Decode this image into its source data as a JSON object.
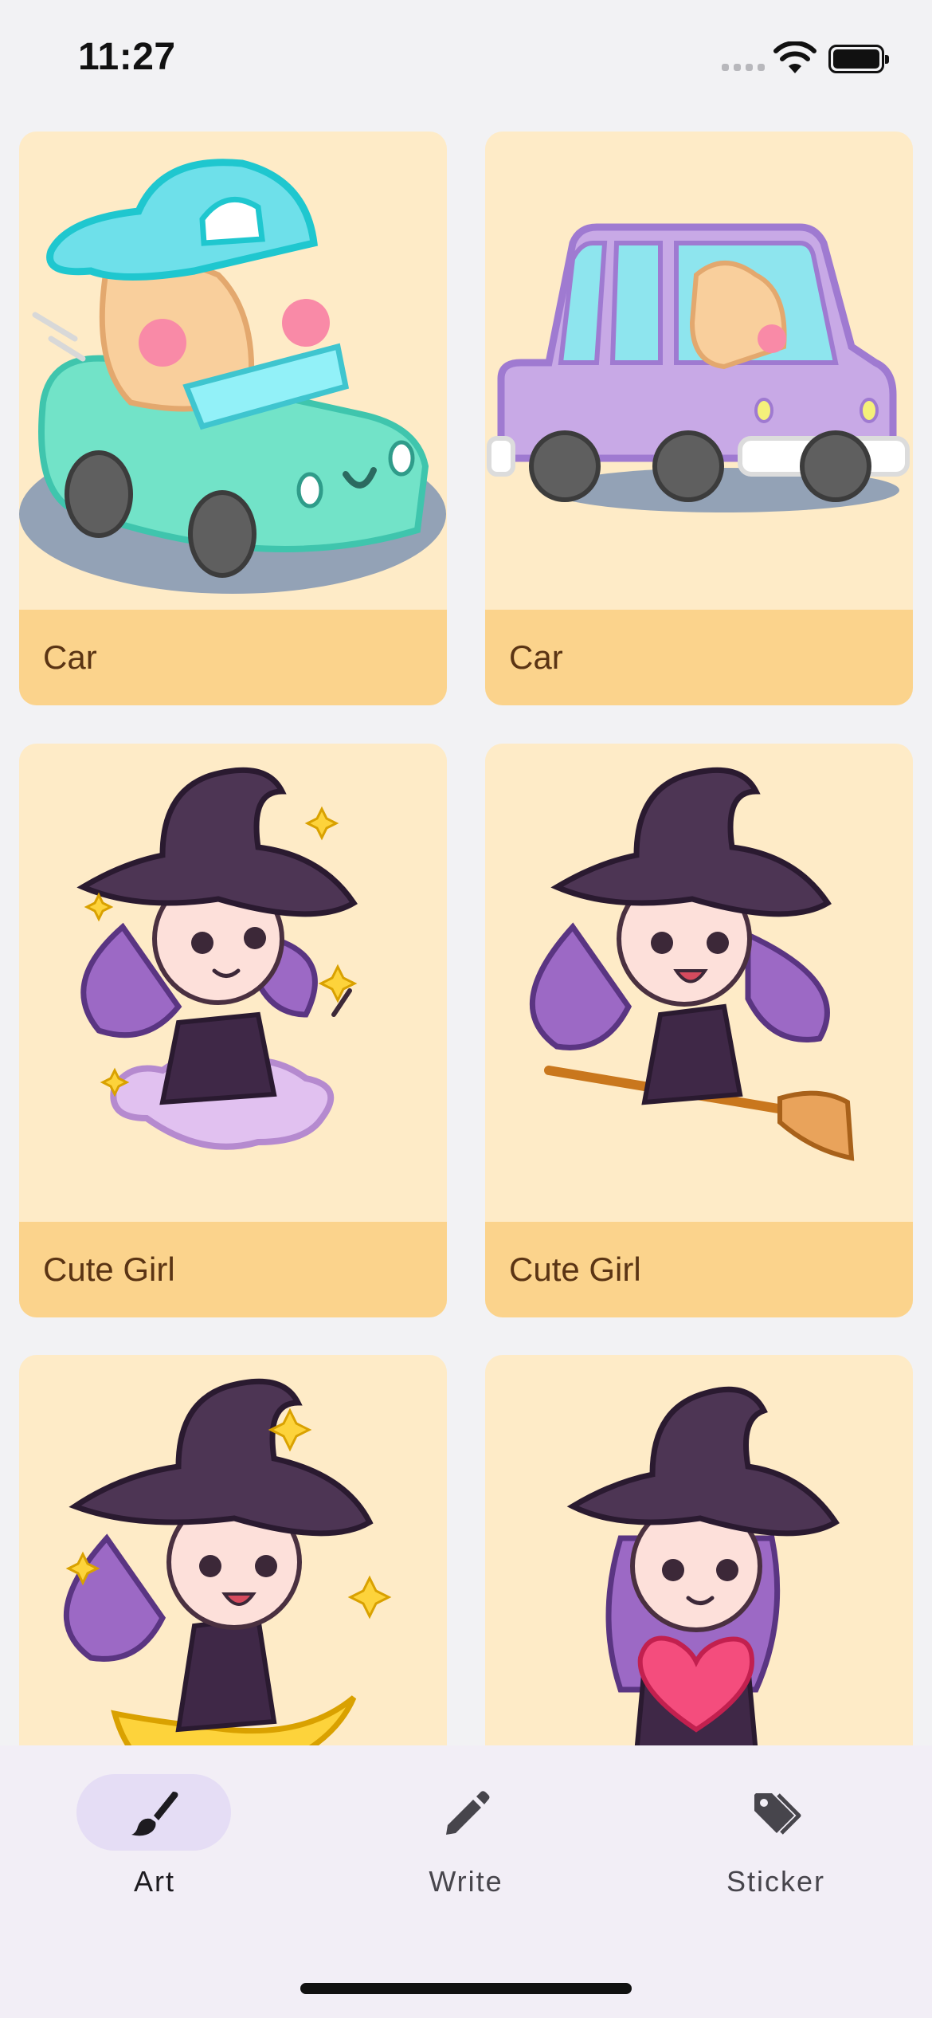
{
  "status_bar": {
    "time": "11:27"
  },
  "cards": [
    {
      "label": "Car",
      "art": "hamster-green-car"
    },
    {
      "label": "Car",
      "art": "hamster-purple-car"
    },
    {
      "label": "Cute Girl",
      "art": "witch-on-cloud"
    },
    {
      "label": "Cute Girl",
      "art": "witch-on-broom"
    },
    {
      "label": "",
      "art": "witch-on-moon"
    },
    {
      "label": "",
      "art": "witch-with-heart"
    }
  ],
  "tabs": [
    {
      "label": "Art",
      "icon": "paintbrush-icon",
      "active": true
    },
    {
      "label": "Write",
      "icon": "pencil-icon",
      "active": false
    },
    {
      "label": "Sticker",
      "icon": "tag-icon",
      "active": false
    }
  ],
  "colors": {
    "card_bg": "#feebc7",
    "caption_bg": "#fbd38c",
    "caption_text": "#5a3414",
    "active_tab_pill": "#e5ddf5",
    "tab_bar_bg": "#f2eef6"
  }
}
